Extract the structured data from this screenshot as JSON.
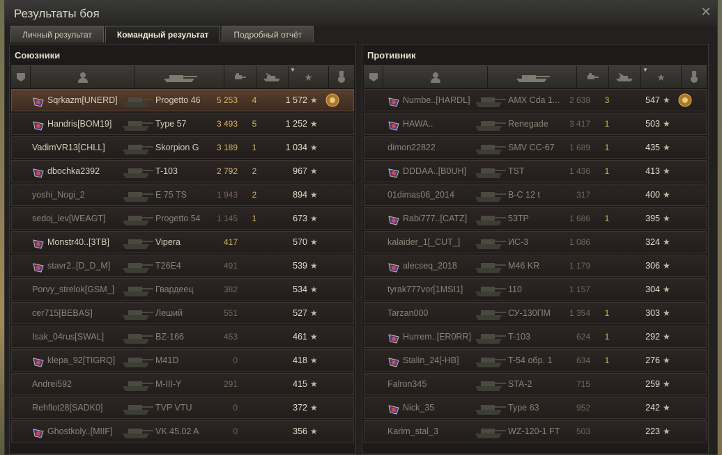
{
  "window": {
    "title": "Результаты боя"
  },
  "tabs": [
    {
      "label": "Личный результат",
      "active": false
    },
    {
      "label": "Командный результат",
      "active": true
    },
    {
      "label": "Подробный отчёт",
      "active": false
    }
  ],
  "allies": {
    "title": "Союзники",
    "rows": [
      {
        "player": "Sqrkazm[UNERD]",
        "badge": "clan-emblem-icon",
        "tank": "Progetto 46",
        "damage": "5 253",
        "kills": "4",
        "xp": "1 572",
        "medal": true,
        "alive": true,
        "highlight": true
      },
      {
        "player": "Handris[BOM19]",
        "badge": "clan-emblem-icon",
        "tank": "Type 57",
        "damage": "3 493",
        "kills": "5",
        "xp": "1 252",
        "alive": true
      },
      {
        "player": "VadimVR13[CHLL]",
        "badge": "",
        "tank": "Skorpion G",
        "damage": "3 189",
        "kills": "1",
        "xp": "1 034",
        "alive": true
      },
      {
        "player": "dbochka2392",
        "badge": "clan-emblem-icon",
        "tank": "T-103",
        "damage": "2 792",
        "kills": "2",
        "xp": "967",
        "alive": true
      },
      {
        "player": "yoshi_Nogi_2",
        "badge": "",
        "tank": "E 75 TS",
        "damage": "1 943",
        "kills": "2",
        "xp": "894",
        "alive": false
      },
      {
        "player": "sedoj_lev[WEAGT]",
        "badge": "",
        "tank": "Progetto 54",
        "damage": "1 145",
        "kills": "1",
        "xp": "673",
        "alive": false
      },
      {
        "player": "Monstr40..[3TB]",
        "badge": "clan-emblem-icon",
        "tank": "Vipera",
        "damage": "417",
        "kills": "",
        "xp": "570",
        "alive": true
      },
      {
        "player": "stavr2..[D_D_M]",
        "badge": "clan-emblem-icon",
        "tank": "T26E4",
        "damage": "491",
        "kills": "",
        "xp": "539",
        "alive": false
      },
      {
        "player": "Porvy_strelok[GSM_]",
        "badge": "",
        "tank": "Гвардеец",
        "damage": "382",
        "kills": "",
        "xp": "534",
        "alive": false
      },
      {
        "player": "cer715[BEBAS]",
        "badge": "",
        "tank": "Леший",
        "damage": "551",
        "kills": "",
        "xp": "527",
        "alive": false
      },
      {
        "player": "Isak_04rus[SWAL]",
        "badge": "",
        "tank": "BZ-166",
        "damage": "453",
        "kills": "",
        "xp": "461",
        "alive": false
      },
      {
        "player": "klepa_92[TIGRQ]",
        "badge": "clan-emblem-icon",
        "tank": "M41D",
        "damage": "0",
        "kills": "",
        "xp": "418",
        "alive": false
      },
      {
        "player": "Andrei592",
        "badge": "",
        "tank": "M-III-Y",
        "damage": "291",
        "kills": "",
        "xp": "415",
        "alive": false
      },
      {
        "player": "Rehflot28[SADK0]",
        "badge": "",
        "tank": "TVP VTU",
        "damage": "0",
        "kills": "",
        "xp": "372",
        "alive": false
      },
      {
        "player": "Ghostkoly..[MIIF]",
        "badge": "clan-emblem-icon",
        "tank": "VK 45.02 A",
        "damage": "0",
        "kills": "",
        "xp": "356",
        "alive": false
      }
    ]
  },
  "enemies": {
    "title": "Противник",
    "rows": [
      {
        "player": "Numbe..[HARDL]",
        "badge": "clan-emblem-icon",
        "tank": "AMX Cda 1...",
        "damage": "2 638",
        "kills": "3",
        "xp": "547",
        "medal": true,
        "alive": false
      },
      {
        "player": "HAWA..",
        "badge": "clan-emblem-icon",
        "tank": "Renegade",
        "damage": "3 417",
        "kills": "1",
        "xp": "503",
        "alive": false
      },
      {
        "player": "dimon22822",
        "badge": "",
        "tank": "SMV CC-67",
        "damage": "1 689",
        "kills": "1",
        "xp": "435",
        "alive": false
      },
      {
        "player": "DDDAA..[B0UH]",
        "badge": "clan-emblem-icon",
        "tank": "TST",
        "damage": "1 436",
        "kills": "1",
        "xp": "413",
        "alive": false
      },
      {
        "player": "01dimas06_2014",
        "badge": "",
        "tank": "B-C 12 t",
        "damage": "317",
        "kills": "",
        "xp": "400",
        "alive": false
      },
      {
        "player": "Rabi777..[CATZ]",
        "badge": "clan-emblem-icon",
        "tank": "53TP",
        "damage": "1 686",
        "kills": "1",
        "xp": "395",
        "alive": false
      },
      {
        "player": "kalaider_1[_CUT_]",
        "badge": "",
        "tank": "ИС-3",
        "damage": "1 086",
        "kills": "",
        "xp": "324",
        "alive": false
      },
      {
        "player": "alecseq_2018",
        "badge": "clan-emblem-icon",
        "tank": "M46 KR",
        "damage": "1 179",
        "kills": "",
        "xp": "306",
        "alive": false
      },
      {
        "player": "tyrak777vor[1MSI1]",
        "badge": "",
        "tank": "110",
        "damage": "1 157",
        "kills": "",
        "xp": "304",
        "alive": false
      },
      {
        "player": "Tarzan000",
        "badge": "",
        "tank": "СУ-130ПМ",
        "damage": "1 354",
        "kills": "1",
        "xp": "303",
        "alive": false
      },
      {
        "player": "Hurrem..[ER0RR]",
        "badge": "clan-emblem-icon",
        "tank": "T-103",
        "damage": "624",
        "kills": "1",
        "xp": "292",
        "alive": false
      },
      {
        "player": "Stalin_24[-HB]",
        "badge": "clan-emblem-icon",
        "tank": "T-54 обр. 1",
        "damage": "634",
        "kills": "1",
        "xp": "276",
        "alive": false
      },
      {
        "player": "Falron345",
        "badge": "",
        "tank": "STA-2",
        "damage": "715",
        "kills": "",
        "xp": "259",
        "alive": false
      },
      {
        "player": "Nick_35",
        "badge": "clan-emblem-icon",
        "tank": "Type 63",
        "damage": "952",
        "kills": "",
        "xp": "242",
        "alive": false
      },
      {
        "player": "Karim_stal_3",
        "badge": "",
        "tank": "WZ-120-1 FT",
        "damage": "503",
        "kills": "",
        "xp": "223",
        "alive": false
      }
    ]
  },
  "colors": {
    "accent": "#d7b45a",
    "highlight_row": "#5a3e2c"
  }
}
